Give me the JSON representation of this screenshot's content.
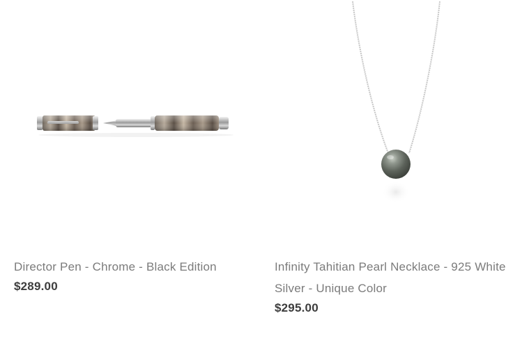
{
  "products": [
    {
      "title": "Director Pen - Chrome - Black Edition",
      "price": "$289.00",
      "image_icon": "fountain-pen-image"
    },
    {
      "title": "Infinity Tahitian Pearl Necklace - 925 White Silver - Unique Color",
      "price": "$295.00",
      "image_icon": "pearl-necklace-image"
    }
  ]
}
